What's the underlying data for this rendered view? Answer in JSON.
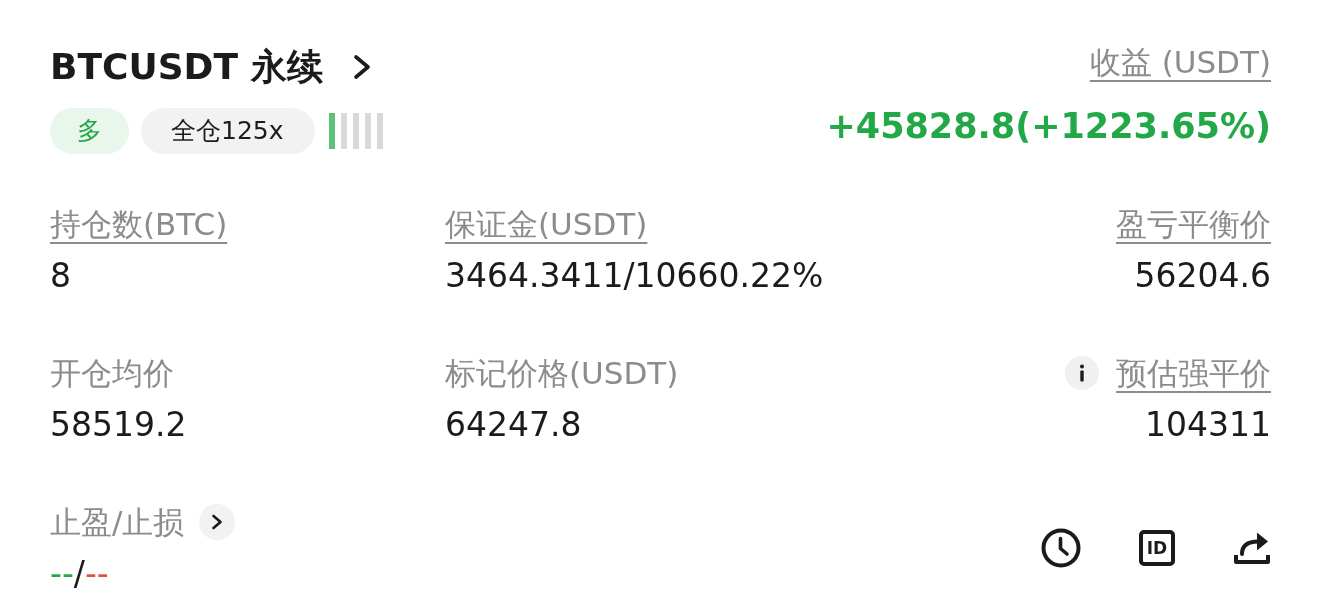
{
  "header": {
    "title": "BTCUSDT 永续",
    "side": {
      "label": "多",
      "kind": "long"
    },
    "margin_mode": "全仓125x",
    "leverage_meter": {
      "level": 0.2
    }
  },
  "pnl": {
    "label": "收益 (USDT)",
    "value": "+45828.8(+1223.65%)",
    "kind": "profit"
  },
  "stats": [
    {
      "label": "持仓数(BTC)",
      "value": "8",
      "underlined": true,
      "info": false
    },
    {
      "label": "保证金(USDT)",
      "value": "3464.3411/10660.22%",
      "underlined": true,
      "info": false
    },
    {
      "label": "盈亏平衡价",
      "value": "56204.6",
      "underlined": true,
      "info": false
    },
    {
      "label": "开仓均价",
      "value": "58519.2",
      "underlined": false,
      "info": false
    },
    {
      "label": "标记价格(USDT)",
      "value": "64247.8",
      "underlined": false,
      "info": false
    },
    {
      "label": "预估强平价",
      "value": "104311",
      "underlined": true,
      "info": true
    }
  ],
  "tp_sl": {
    "label": "止盈/止损",
    "take_profit": {
      "text": "--",
      "color": "#22a846"
    },
    "separator": "/",
    "stop_loss": {
      "text": "--",
      "color": "#e0533f"
    }
  },
  "actions": [
    {
      "kind": "history"
    },
    {
      "kind": "id",
      "text": "ID"
    },
    {
      "kind": "share"
    }
  ]
}
